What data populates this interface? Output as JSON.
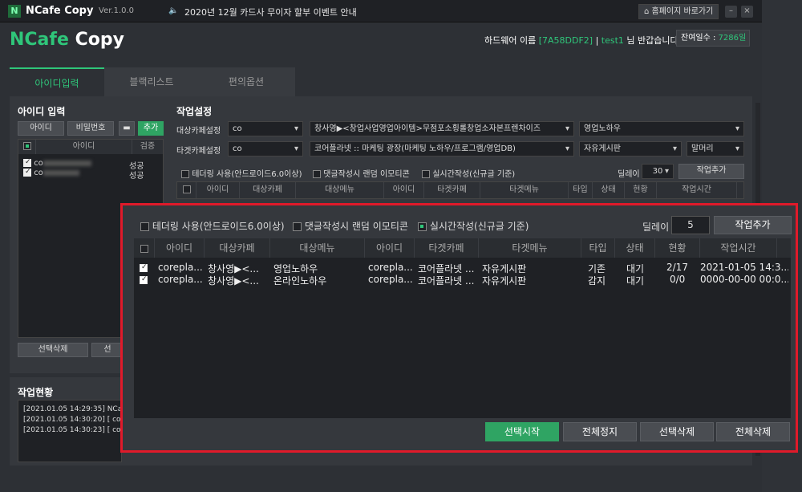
{
  "titlebar": {
    "logo": "N",
    "app": "NCafe Copy",
    "version": "Ver.1.0.0",
    "notice": "2020년 12월 카드사 무이자 할부 이벤트 안내",
    "homepage": "홈페이지 바로가기"
  },
  "brand": {
    "n": "NCafe",
    "rest": " Copy"
  },
  "hardware": {
    "prefix": "하드웨어 이름 ",
    "code": "[7A58DDF2]",
    "sep": " | ",
    "user": "test1",
    "suffix": " 님 반갑습니다!"
  },
  "days": {
    "label": "잔여일수 : ",
    "value": "7286일"
  },
  "tabs": [
    "아이디입력",
    "블랙리스트",
    "편의옵션"
  ],
  "id_input": {
    "title": "아이디 입력",
    "id_btn": "아이디",
    "pw_btn": "비밀번호",
    "add_btn": "추가",
    "col_id": "아이디",
    "col_check": "검증",
    "rows": [
      {
        "id": "co",
        "status": "성공"
      },
      {
        "id": "co",
        "status": "성공"
      }
    ],
    "delete_btn": "선택삭제",
    "delete_btn2": "선"
  },
  "job": {
    "title": "작업설정",
    "target_label": "대상카페설정",
    "tacket_label": "타겟카페설정",
    "target_sel": "co",
    "target_menu": "창사영▶<창업사업영업아이템>무점포소횡롤창업소자본프렌차이즈",
    "target_board": "영업노하우",
    "tacket_sel": "co",
    "tacket_menu": "코어플라넷 :: 마케팅 광장(마케팅 노하우/프로그램/영업DB)",
    "tacket_board": "자유게시판",
    "tacket_head": "말머리",
    "opt1": "테더링 사용(안드로이드6.0이상)",
    "opt2": "댓글작성시 랜덤 이모티콘",
    "opt3": "실시간작성(신규글 기준)",
    "delay_label": "딜레이",
    "delay": "30",
    "add_job": "작업추가",
    "cols": [
      "아이디",
      "대상카페",
      "대상메뉴",
      "아이디",
      "타겟카페",
      "타겟메뉴",
      "타입",
      "상태",
      "현황",
      "작업시간"
    ]
  },
  "status": {
    "title": "작업현황",
    "logs": [
      "[2021.01.05 14:29:35]  NCat",
      "[2021.01.05 14:30:20]  [ co",
      "[2021.01.05 14:30:23]  [ co"
    ]
  },
  "overlay": {
    "opt1": "테더링 사용(안드로이드6.0이상)",
    "opt2": "댓글작성시 랜덤 이모티콘",
    "opt3": "실시간작성(신규글 기준)",
    "delay_label": "딜레이",
    "delay": "5",
    "add_job": "작업추가",
    "cols": [
      "아이디",
      "대상카페",
      "대상메뉴",
      "아이디",
      "타겟카페",
      "타겟메뉴",
      "타입",
      "상태",
      "현황",
      "작업시간"
    ],
    "rows": [
      [
        "corepla...",
        "창사영▶<...",
        "영업노하우",
        "corepla...",
        "코어플라넷 ...",
        "자유게시판",
        "기존",
        "대기",
        "2/17",
        "2021-01-05 14:3..."
      ],
      [
        "corepla...",
        "창사영▶<...",
        "온라인노하우",
        "corepla...",
        "코어플라넷 ...",
        "자유게시판",
        "감지",
        "대기",
        "0/0",
        "0000-00-00 00:0..."
      ]
    ],
    "btn_start": "선택시작",
    "btn_stop": "전체정지",
    "btn_del": "선택삭제",
    "btn_delall": "전체삭제"
  },
  "colors": {
    "accent": "#2fc67a",
    "highlight": "#e01a2a"
  }
}
